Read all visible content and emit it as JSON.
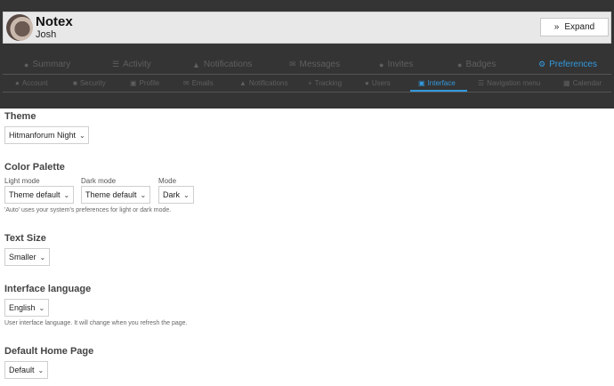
{
  "header": {
    "title": "Notex",
    "user_name": "Josh",
    "expand_label": "Expand"
  },
  "nav_primary": [
    {
      "label": "Summary",
      "icon": "user-icon"
    },
    {
      "label": "Activity",
      "icon": "list-icon"
    },
    {
      "label": "Notifications",
      "icon": "bell-icon"
    },
    {
      "label": "Messages",
      "icon": "envelope-icon"
    },
    {
      "label": "Invites",
      "icon": "user-plus-icon"
    },
    {
      "label": "Badges",
      "icon": "circle-icon"
    },
    {
      "label": "Preferences",
      "icon": "gear-icon",
      "active": true
    }
  ],
  "nav_secondary": [
    {
      "label": "Account",
      "icon": "user-circle-icon"
    },
    {
      "label": "Security",
      "icon": "lock-icon"
    },
    {
      "label": "Profile",
      "icon": "id-card-icon"
    },
    {
      "label": "Emails",
      "icon": "envelope-icon"
    },
    {
      "label": "Notifications",
      "icon": "bell-icon"
    },
    {
      "label": "Tracking",
      "icon": "plus-icon"
    },
    {
      "label": "Users",
      "icon": "users-icon"
    },
    {
      "label": "Interface",
      "icon": "desktop-icon",
      "active": true
    },
    {
      "label": "Navigation menu",
      "icon": "bars-icon"
    },
    {
      "label": "Calendar",
      "icon": "calendar-icon"
    }
  ],
  "theme": {
    "title": "Theme",
    "value": "Hitmanforum Night"
  },
  "color_palette": {
    "title": "Color Palette",
    "light_mode_label": "Light mode",
    "light_mode_value": "Theme default",
    "dark_mode_label": "Dark mode",
    "dark_mode_value": "Theme default",
    "mode_label": "Mode",
    "mode_value": "Dark",
    "help": "'Auto' uses your system's preferences for light or dark mode."
  },
  "text_size": {
    "title": "Text Size",
    "value": "Smaller"
  },
  "interface_language": {
    "title": "Interface language",
    "value": "English",
    "help": "User interface language. It will change when you refresh the page."
  },
  "default_home_page": {
    "title": "Default Home Page",
    "value": "Default"
  },
  "colors": {
    "header_bg": "#343434",
    "accent": "#3399dd",
    "userbar_bg": "#e8e8e8"
  }
}
